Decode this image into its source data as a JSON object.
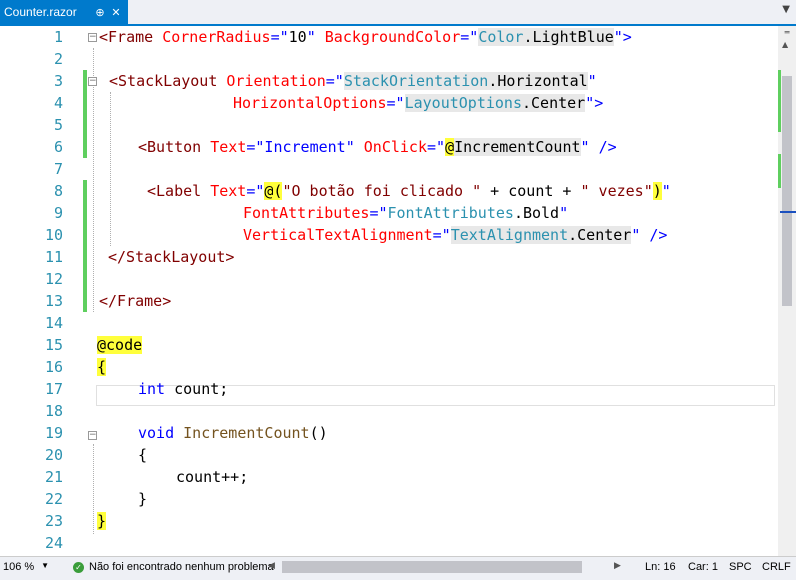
{
  "tab": {
    "title": "Counter.razor",
    "pin": "⊕",
    "close": "✕",
    "dropdown": "▼"
  },
  "lines": [
    {
      "n": "1"
    },
    {
      "n": "2"
    },
    {
      "n": "3"
    },
    {
      "n": "4"
    },
    {
      "n": "5"
    },
    {
      "n": "6"
    },
    {
      "n": "7"
    },
    {
      "n": "8"
    },
    {
      "n": "9"
    },
    {
      "n": "10"
    },
    {
      "n": "11"
    },
    {
      "n": "12"
    },
    {
      "n": "13"
    },
    {
      "n": "14"
    },
    {
      "n": "15"
    },
    {
      "n": "16"
    },
    {
      "n": "17"
    },
    {
      "n": "18"
    },
    {
      "n": "19"
    },
    {
      "n": "20"
    },
    {
      "n": "21"
    },
    {
      "n": "22"
    },
    {
      "n": "23"
    },
    {
      "n": "24"
    }
  ],
  "code": {
    "l1": [
      "<Frame ",
      "CornerRadius",
      "=\"",
      "10",
      "\" ",
      "BackgroundColor",
      "=\"",
      "Color",
      ".LightBlue",
      "\">"
    ],
    "l3": [
      "<StackLayout ",
      "Orientation",
      "=\"",
      "StackOrientation",
      ".Horizontal",
      "\""
    ],
    "l4": [
      "HorizontalOptions",
      "=\"",
      "LayoutOptions",
      ".Center",
      "\">"
    ],
    "l6": [
      "<Button ",
      "Text",
      "=\"Increment\" ",
      "OnClick",
      "=\"",
      "@",
      "IncrementCount",
      "\" />"
    ],
    "l8": [
      "<Label ",
      "Text",
      "=\"",
      "@(",
      "\"O botão foi clicado \"",
      " + count + ",
      "\" vezes\"",
      ")",
      "\""
    ],
    "l9": [
      "FontAttributes",
      "=\"",
      "FontAttributes",
      ".Bold",
      "\""
    ],
    "l10": [
      "VerticalTextAlignment",
      "=\"",
      "TextAlignment",
      ".Center",
      "\" />"
    ],
    "l11": [
      "</StackLayout>"
    ],
    "l13": [
      "</Frame>"
    ],
    "l15": [
      "@code"
    ],
    "l16": [
      "{"
    ],
    "l17": [
      "int",
      " count;"
    ],
    "l19": [
      "void",
      " ",
      "IncrementCount",
      "()"
    ],
    "l20": [
      "{"
    ],
    "l21": [
      "count++;"
    ],
    "l22": [
      "}"
    ],
    "l23": [
      "}"
    ]
  },
  "fold": "−",
  "status": {
    "zoom": "106 %",
    "zoom_arrow": "▼",
    "ok_icon": "check-circle-icon",
    "ok_text": "Não foi encontrado nenhum problema",
    "ln": "Ln: 16",
    "car": "Car: 1",
    "spc": "SPC",
    "crlf": "CRLF"
  }
}
